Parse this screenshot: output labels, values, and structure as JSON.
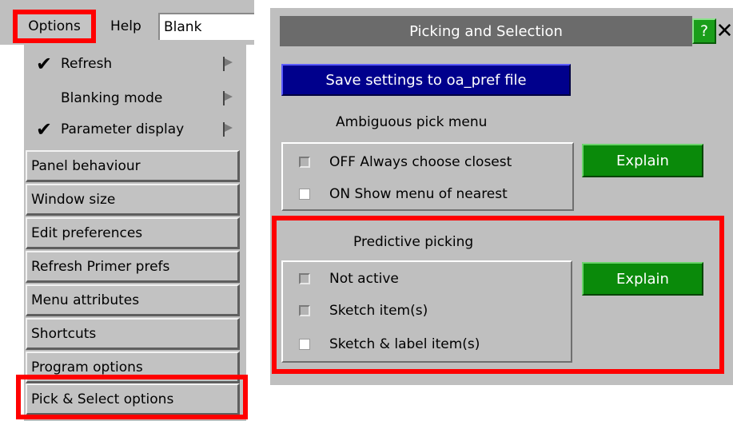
{
  "menubar": {
    "options_label": "Options",
    "help_label": "Help",
    "blank_value": "Blank"
  },
  "options_menu": {
    "toggle_items": [
      {
        "label": "Refresh",
        "checked": true
      },
      {
        "label": "Blanking mode",
        "checked": false
      },
      {
        "label": "Parameter display",
        "checked": true
      }
    ],
    "buttons": [
      {
        "label": "Panel behaviour"
      },
      {
        "label": "Window size"
      },
      {
        "label": "Edit preferences"
      },
      {
        "label": "Refresh Primer prefs"
      },
      {
        "label": "Menu attributes"
      },
      {
        "label": "Shortcuts"
      },
      {
        "label": "Program options"
      },
      {
        "label": "Pick & Select options"
      }
    ]
  },
  "panel": {
    "title": "Picking and Selection",
    "help_symbol": "?",
    "close_symbol": "✕",
    "save_label": "Save settings to oa_pref file",
    "ambiguous": {
      "title": "Ambiguous pick menu",
      "options": [
        {
          "label": "OFF  Always choose closest",
          "state": "off"
        },
        {
          "label": "ON  Show menu of nearest",
          "state": "on"
        }
      ],
      "explain_label": "Explain"
    },
    "predictive": {
      "title": "Predictive picking",
      "options": [
        {
          "label": "Not active",
          "state": "off"
        },
        {
          "label": "Sketch item(s)",
          "state": "off"
        },
        {
          "label": "Sketch & label item(s)",
          "state": "on"
        }
      ],
      "explain_label": "Explain"
    }
  },
  "colors": {
    "highlight": "#ff0000",
    "title_bar": "#6b6b6b",
    "save_button": "#00008c",
    "explain_button": "#0a8a0a",
    "panel_bg": "#bfbfbf"
  }
}
